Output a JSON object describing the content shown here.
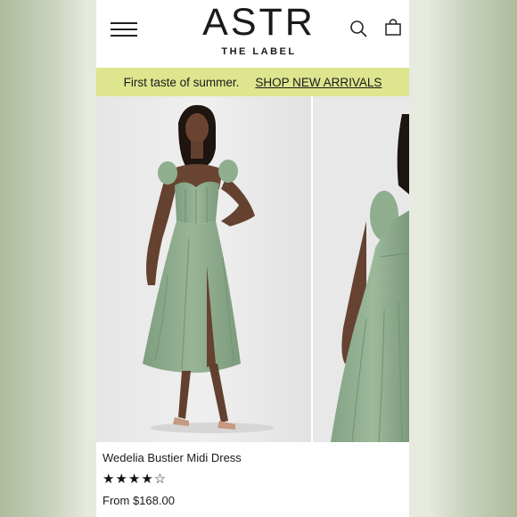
{
  "header": {
    "logo_main": "ASTR",
    "logo_sub": "THE LABEL",
    "icons": [
      "menu-icon",
      "search-icon",
      "shopping-bag-icon"
    ]
  },
  "promo": {
    "text": "First taste of summer.",
    "link": "SHOP NEW ARRIVALS",
    "background": "#dde58e"
  },
  "product": {
    "title": "Wedelia Bustier Midi Dress",
    "rating_display": "★★★★☆",
    "rating": 4,
    "rating_max": 5,
    "price": "From $168.00",
    "dress_color": "#8fae8f"
  }
}
